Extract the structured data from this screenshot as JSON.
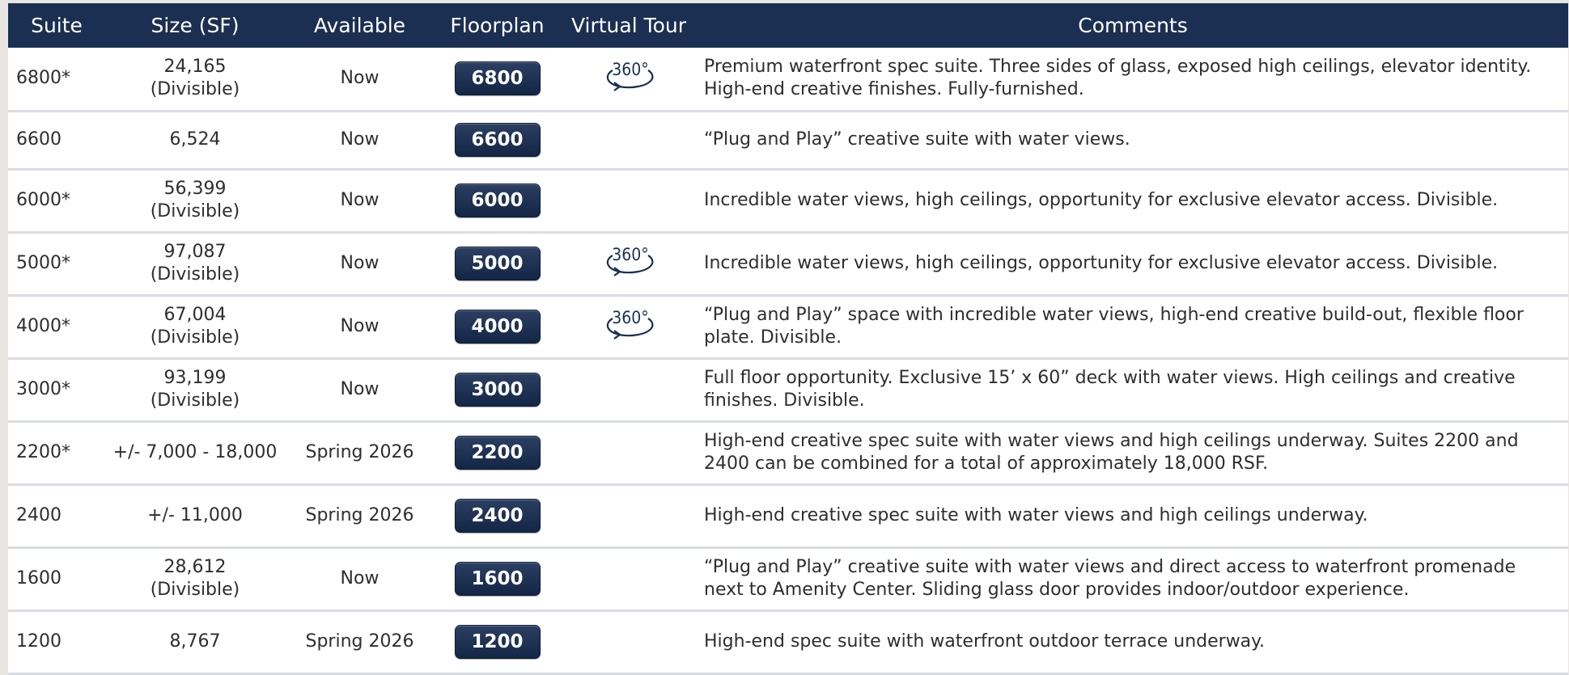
{
  "header": {
    "suite": "Suite",
    "size": "Size (SF)",
    "available": "Available",
    "floorplan": "Floorplan",
    "virtual_tour": "Virtual Tour",
    "comments": "Comments"
  },
  "tour_icon_label": "360°",
  "colors": {
    "header_bg": "#1b2f52",
    "button_bg": "#1b2f52",
    "row_divider": "#d9dde3"
  },
  "rows": [
    {
      "suite": "6800*",
      "size_line1": "24,165",
      "size_line2": "(Divisible)",
      "available": "Now",
      "floorplan": "6800",
      "has_tour": true,
      "comment": "Premium waterfront spec suite. Three sides of glass, exposed high ceilings, elevator identity. High-end creative finishes. Fully-furnished."
    },
    {
      "suite": "6600",
      "size_line1": "6,524",
      "size_line2": "",
      "available": "Now",
      "floorplan": "6600",
      "has_tour": false,
      "comment": "“Plug and Play” creative suite with water views."
    },
    {
      "suite": "6000*",
      "size_line1": "56,399",
      "size_line2": "(Divisible)",
      "available": "Now",
      "floorplan": "6000",
      "has_tour": false,
      "comment": "Incredible water views, high ceilings, opportunity for exclusive elevator access. Divisible."
    },
    {
      "suite": "5000*",
      "size_line1": "97,087",
      "size_line2": "(Divisible)",
      "available": "Now",
      "floorplan": "5000",
      "has_tour": true,
      "comment": "Incredible water views, high ceilings, opportunity for exclusive elevator access. Divisible."
    },
    {
      "suite": "4000*",
      "size_line1": "67,004",
      "size_line2": "(Divisible)",
      "available": "Now",
      "floorplan": "4000",
      "has_tour": true,
      "comment": "“Plug and Play” space with incredible water views, high-end creative build-out, flexible floor plate. Divisible."
    },
    {
      "suite": "3000*",
      "size_line1": "93,199",
      "size_line2": "(Divisible)",
      "available": "Now",
      "floorplan": "3000",
      "has_tour": false,
      "comment": "Full floor opportunity. Exclusive 15’ x 60” deck with water views. High ceilings and creative finishes. Divisible."
    },
    {
      "suite": "2200*",
      "size_line1": "+/- 7,000 - 18,000",
      "size_line2": "",
      "available": "Spring 2026",
      "floorplan": "2200",
      "has_tour": false,
      "comment": "High-end creative spec suite with water views and high ceilings underway. Suites 2200 and 2400 can be combined for a total of approximately 18,000 RSF."
    },
    {
      "suite": "2400",
      "size_line1": "+/- 11,000",
      "size_line2": "",
      "available": "Spring 2026",
      "floorplan": "2400",
      "has_tour": false,
      "comment": "High-end creative spec suite with water views and high ceilings underway."
    },
    {
      "suite": "1600",
      "size_line1": "28,612",
      "size_line2": "(Divisible)",
      "available": "Now",
      "floorplan": "1600",
      "has_tour": false,
      "comment": "“Plug and Play” creative suite with water views and direct access to waterfront promenade next to Amenity Center. Sliding glass door provides indoor/outdoor experience."
    },
    {
      "suite": "1200",
      "size_line1": "8,767",
      "size_line2": "",
      "available": "Spring 2026",
      "floorplan": "1200",
      "has_tour": false,
      "comment": "High-end spec suite with waterfront outdoor terrace underway."
    }
  ]
}
